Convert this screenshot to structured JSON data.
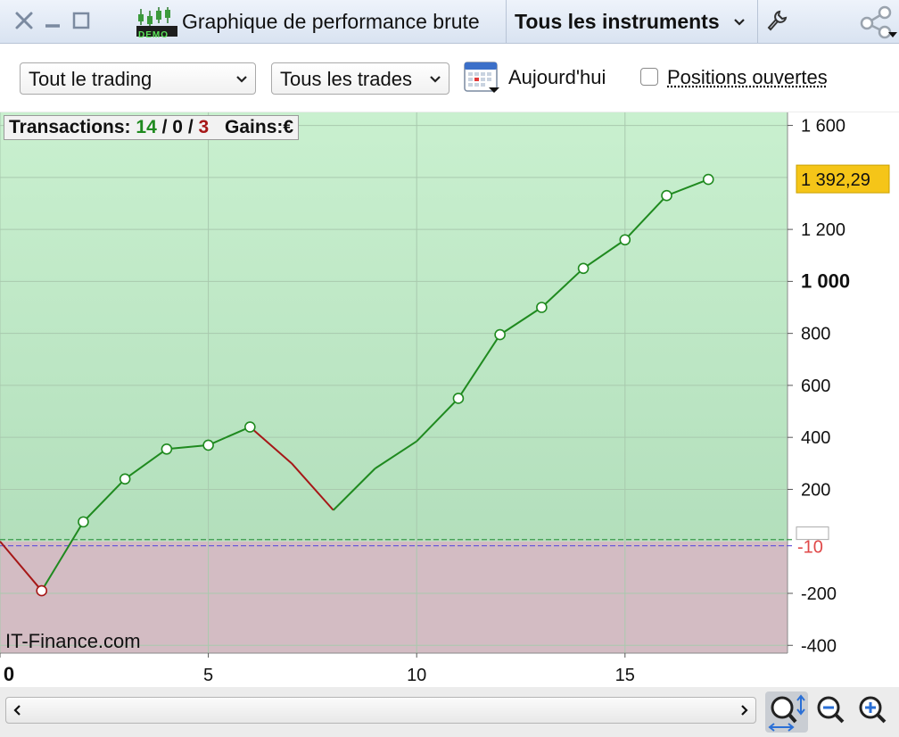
{
  "titlebar": {
    "title": "Graphique de performance brute",
    "demo_badge": "DEMO",
    "instruments_label": "Tous les instruments"
  },
  "toolbar": {
    "trading_select": "Tout le trading",
    "trades_select": "Tous les trades",
    "date_label": "Aujourd'hui",
    "open_positions_label": "Positions ouvertes",
    "open_positions_checked": false
  },
  "stats": {
    "transactions_label": "Transactions:",
    "wins": "14",
    "separator": "/",
    "even": "0",
    "losses": "3",
    "gains_label": "Gains:",
    "currency": "€"
  },
  "watermark": "IT-Finance.com",
  "colors": {
    "profit_zone": "#bfe8c6",
    "loss_zone": "#d3bcc3",
    "line_up": "#1f8a1f",
    "line_down": "#a61717",
    "last_value_badge": "#f5c518",
    "baseline_label": "#e04848"
  },
  "chart_data": {
    "type": "line",
    "x": [
      0,
      1,
      2,
      3,
      4,
      5,
      6,
      7,
      8,
      9,
      10,
      11,
      12,
      13,
      14,
      15,
      16,
      17
    ],
    "y": [
      0,
      -190,
      75,
      240,
      355,
      370,
      440,
      300,
      120,
      280,
      385,
      550,
      795,
      900,
      1050,
      1160,
      1330,
      1392.29
    ],
    "markers_shown_at": [
      1,
      2,
      3,
      4,
      5,
      6,
      11,
      12,
      13,
      14,
      15,
      16,
      17
    ],
    "xlim": [
      0,
      18.9
    ],
    "ylim": [
      -430,
      1650
    ],
    "x_ticks": [
      {
        "value": 0,
        "label": "0",
        "bold": true
      },
      {
        "value": 5,
        "label": "5"
      },
      {
        "value": 10,
        "label": "10"
      },
      {
        "value": 15,
        "label": "15"
      }
    ],
    "y_ticks": [
      {
        "value": 1600,
        "label": "1 600"
      },
      {
        "value": 1200,
        "label": "1 200"
      },
      {
        "value": 1000,
        "label": "1 000",
        "bold": true
      },
      {
        "value": 800,
        "label": "800"
      },
      {
        "value": 600,
        "label": "600"
      },
      {
        "value": 400,
        "label": "400"
      },
      {
        "value": 200,
        "label": "200"
      },
      {
        "value": -200,
        "label": "-200"
      },
      {
        "value": -400,
        "label": "-400"
      }
    ],
    "last_value": 1392.29,
    "last_value_label": "1 392,29",
    "baseline_value": -10,
    "baseline_label": "-10",
    "grid": true,
    "x_gridlines": [
      0,
      5,
      10,
      15
    ],
    "y_gridlines": [
      1600,
      1400,
      1200,
      1000,
      800,
      600,
      400,
      200,
      -200,
      -400
    ]
  }
}
